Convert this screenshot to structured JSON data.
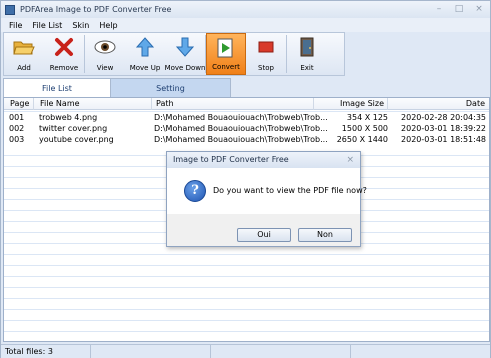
{
  "window": {
    "title": "PDFArea Image to PDF Converter Free",
    "controls": [
      "–",
      "□",
      "×"
    ]
  },
  "menu": [
    "File",
    "File List",
    "Skin",
    "Help"
  ],
  "toolbar": {
    "add": "Add",
    "remove": "Remove",
    "view": "View",
    "move_up": "Move Up",
    "move_down": "Move Down",
    "convert": "Convert",
    "stop": "Stop",
    "exit": "Exit"
  },
  "tabs": {
    "file_list": "File List",
    "setting": "Setting"
  },
  "table": {
    "headers": {
      "page": "Page",
      "file_name": "File Name",
      "path": "Path",
      "image_size": "Image Size",
      "date": "Date"
    },
    "rows": [
      {
        "page": "001",
        "file_name": "trobweb 4.png",
        "path": "D:\\Mohamed Bouaouiouach\\Trobweb\\Trob...",
        "image_size": "354 X 125",
        "date": "2020-02-28 20:04:35"
      },
      {
        "page": "002",
        "file_name": "twitter cover.png",
        "path": "D:\\Mohamed Bouaouiouach\\Trobweb\\Trob...",
        "image_size": "1500 X 500",
        "date": "2020-03-01 18:39:22"
      },
      {
        "page": "003",
        "file_name": "youtube cover.png",
        "path": "D:\\Mohamed Bouaouiouach\\Trobweb\\Trob...",
        "image_size": "2650 X 1440",
        "date": "2020-03-01 18:51:48"
      }
    ]
  },
  "status": {
    "total_files": "Total files: 3"
  },
  "dialog": {
    "title": "Image to PDF Converter Free",
    "close": "×",
    "message": "Do you want to view the PDF file now?",
    "icon_glyph": "?",
    "yes": "Oui",
    "no": "Non"
  },
  "colors": {
    "accent": "#f08018",
    "header_bg": "#dfe8f5",
    "grid_line": "#dbe6f5"
  }
}
